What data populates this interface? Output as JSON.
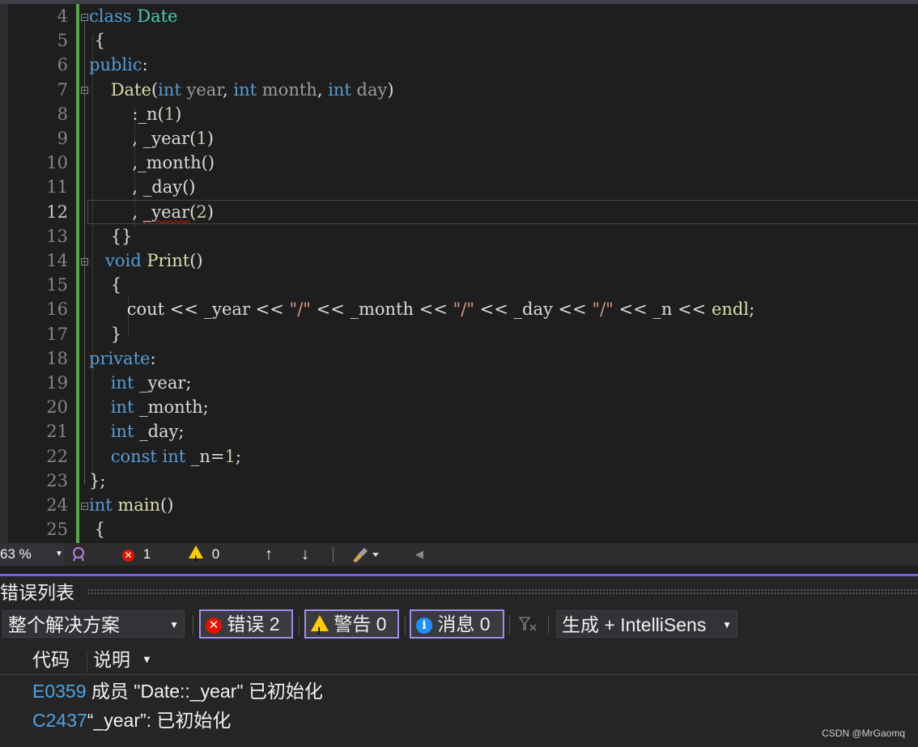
{
  "editor": {
    "line_numbers": [
      "4",
      "5",
      "6",
      "7",
      "8",
      "9",
      "10",
      "11",
      "12",
      "13",
      "14",
      "15",
      "16",
      "17",
      "18",
      "19",
      "20",
      "21",
      "22",
      "23",
      "24",
      "25"
    ],
    "current_line": "12",
    "lines": [
      [
        [
          "kw",
          "class "
        ],
        [
          "ty",
          "Date"
        ]
      ],
      [
        [
          "pl",
          " {"
        ]
      ],
      [
        [
          "kw",
          "public"
        ],
        [
          "pl",
          ":"
        ]
      ],
      [
        [
          "pl",
          "    "
        ],
        [
          "fn",
          "Date"
        ],
        [
          "pl",
          "("
        ],
        [
          "kw",
          "int"
        ],
        [
          "pm",
          " year"
        ],
        [
          "pl",
          ", "
        ],
        [
          "kw",
          "int"
        ],
        [
          "pm",
          " month"
        ],
        [
          "pl",
          ", "
        ],
        [
          "kw",
          "int"
        ],
        [
          "pm",
          " day"
        ],
        [
          "pl",
          ")"
        ]
      ],
      [
        [
          "pl",
          "        :"
        ],
        [
          "mb",
          "_n"
        ],
        [
          "pl",
          "("
        ],
        [
          "nm",
          "1"
        ],
        [
          "pl",
          ")"
        ]
      ],
      [
        [
          "pl",
          "        , "
        ],
        [
          "mb",
          "_year"
        ],
        [
          "pl",
          "("
        ],
        [
          "nm",
          "1"
        ],
        [
          "pl",
          ")"
        ]
      ],
      [
        [
          "pl",
          "        ,"
        ],
        [
          "mb",
          "_month"
        ],
        [
          "pl",
          "()"
        ]
      ],
      [
        [
          "pl",
          "        , "
        ],
        [
          "mb",
          "_day"
        ],
        [
          "pl",
          "()"
        ]
      ],
      [
        [
          "pl",
          "        , "
        ],
        [
          "mb squig",
          "_year"
        ],
        [
          "pl",
          "("
        ],
        [
          "nm",
          "2"
        ],
        [
          "pl",
          ")"
        ]
      ],
      [
        [
          "pl",
          "    {}"
        ]
      ],
      [
        [
          "pl",
          "   "
        ],
        [
          "kw",
          "void "
        ],
        [
          "fn",
          "Print"
        ],
        [
          "pl",
          "()"
        ]
      ],
      [
        [
          "pl",
          "    {"
        ]
      ],
      [
        [
          "pl",
          "       cout << "
        ],
        [
          "mb",
          "_year"
        ],
        [
          "pl",
          " << "
        ],
        [
          "st",
          "\"/\""
        ],
        [
          "pl",
          " << "
        ],
        [
          "mb",
          "_month"
        ],
        [
          "pl",
          " << "
        ],
        [
          "st",
          "\"/\""
        ],
        [
          "pl",
          " << "
        ],
        [
          "mb",
          "_day"
        ],
        [
          "pl",
          " << "
        ],
        [
          "st",
          "\"/\""
        ],
        [
          "pl",
          " << "
        ],
        [
          "mb",
          "_n"
        ],
        [
          "pl",
          " << "
        ],
        [
          "fn",
          "endl"
        ],
        [
          "pl",
          ";"
        ]
      ],
      [
        [
          "pl",
          "    }"
        ]
      ],
      [
        [
          "kw",
          "private"
        ],
        [
          "pl",
          ":"
        ]
      ],
      [
        [
          "pl",
          "    "
        ],
        [
          "kw",
          "int"
        ],
        [
          "mb",
          " _year"
        ],
        [
          "pl",
          ";"
        ]
      ],
      [
        [
          "pl",
          "    "
        ],
        [
          "kw",
          "int"
        ],
        [
          "mb",
          " _month"
        ],
        [
          "pl",
          ";"
        ]
      ],
      [
        [
          "pl",
          "    "
        ],
        [
          "kw",
          "int"
        ],
        [
          "mb",
          " _day"
        ],
        [
          "pl",
          ";"
        ]
      ],
      [
        [
          "pl",
          "    "
        ],
        [
          "kw",
          "const int"
        ],
        [
          "mb",
          " _n"
        ],
        [
          "pl",
          "="
        ],
        [
          "nm",
          "1"
        ],
        [
          "pl",
          ";"
        ]
      ],
      [
        [
          "pl",
          "};"
        ]
      ],
      [
        [
          "kw",
          "int "
        ],
        [
          "fn",
          "main"
        ],
        [
          "pl",
          "()"
        ]
      ],
      [
        [
          "pl",
          " {"
        ]
      ]
    ]
  },
  "statusbar": {
    "zoom": "63 %",
    "errors": "1",
    "warnings": "0",
    "up_arrow": "↑",
    "down_arrow": "↓"
  },
  "error_list": {
    "title": "错误列表",
    "scope": "整个解决方案",
    "errors_filter": "错误 2",
    "warnings_filter": "警告 0",
    "messages_filter": "消息 0",
    "source": "生成 + IntelliSens",
    "col_code": "代码",
    "col_desc": "说明",
    "rows": [
      {
        "code": "E0359",
        "desc": " 成员 \"Date::_year\" 已初始化"
      },
      {
        "code": "C2437",
        "desc": "“_year”: 已初始化"
      }
    ]
  },
  "watermark": "CSDN @MrGaomq",
  "colors": {
    "accent": "#7160e8",
    "error": "#e51400",
    "warning": "#ffcc00",
    "info": "#1e90ff",
    "changed_bar": "#57a64a"
  }
}
